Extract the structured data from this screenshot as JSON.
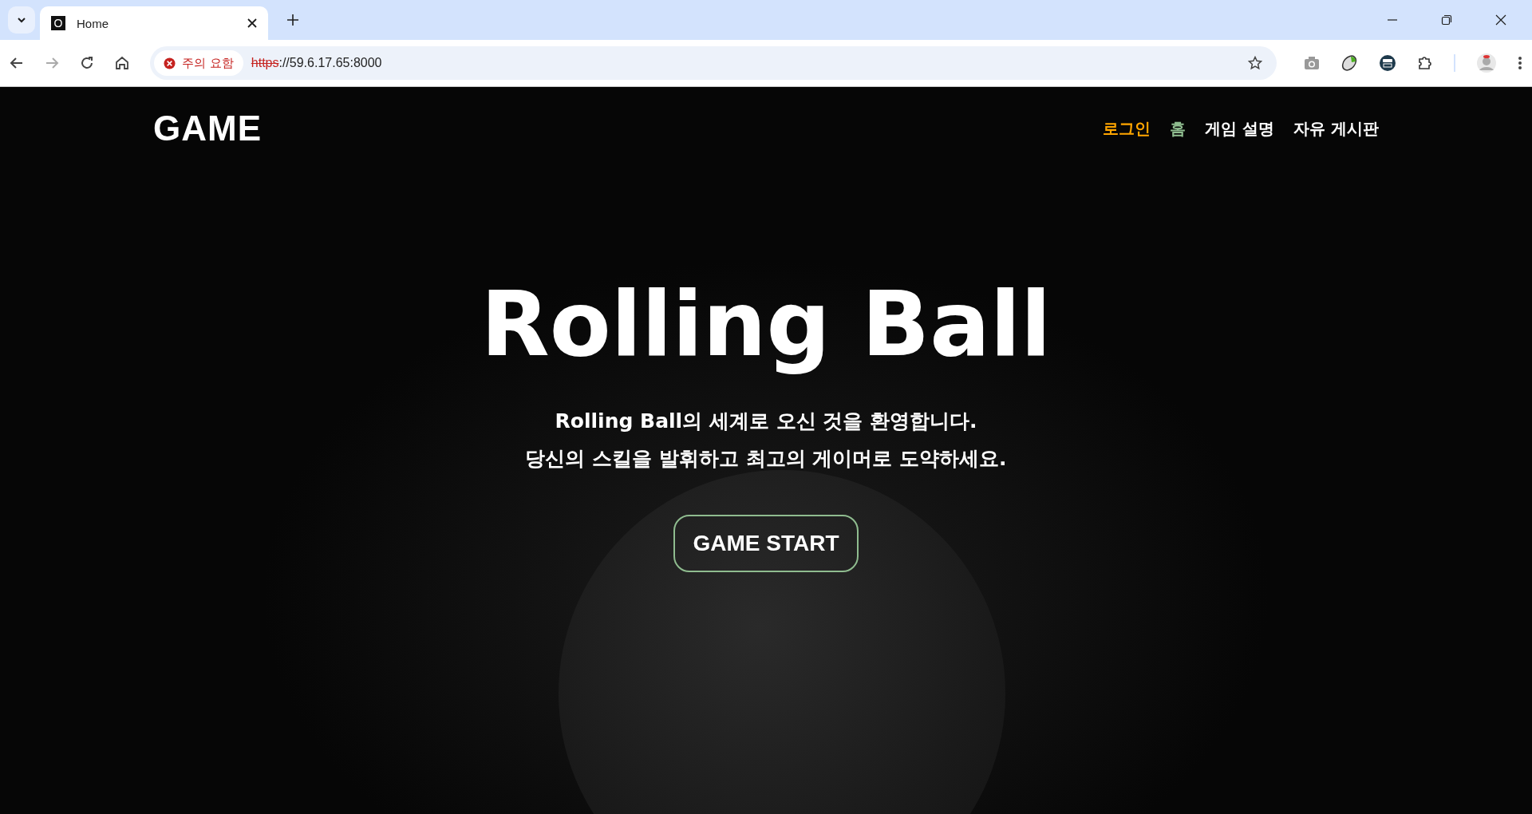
{
  "browser": {
    "tab_title": "Home",
    "tab_favicon": "O",
    "security_label": "주의 요함",
    "url_scheme": "https",
    "url_rest": "://59.6.17.65:8000"
  },
  "site": {
    "logo": "GAME",
    "nav": [
      {
        "label": "로그인",
        "color": "#ffa500"
      },
      {
        "label": "홈",
        "color": "#8fbc8f"
      },
      {
        "label": "게임 설명",
        "color": "#ffffff"
      },
      {
        "label": "자유 게시판",
        "color": "#ffffff"
      }
    ]
  },
  "hero": {
    "title": "Rolling Ball",
    "lines": [
      "Rolling Ball의 세계로 오신 것을 환영합니다.",
      "당신의 스킬을 발휘하고 최고의 게이머로 도약하세요."
    ],
    "button": "GAME START"
  }
}
